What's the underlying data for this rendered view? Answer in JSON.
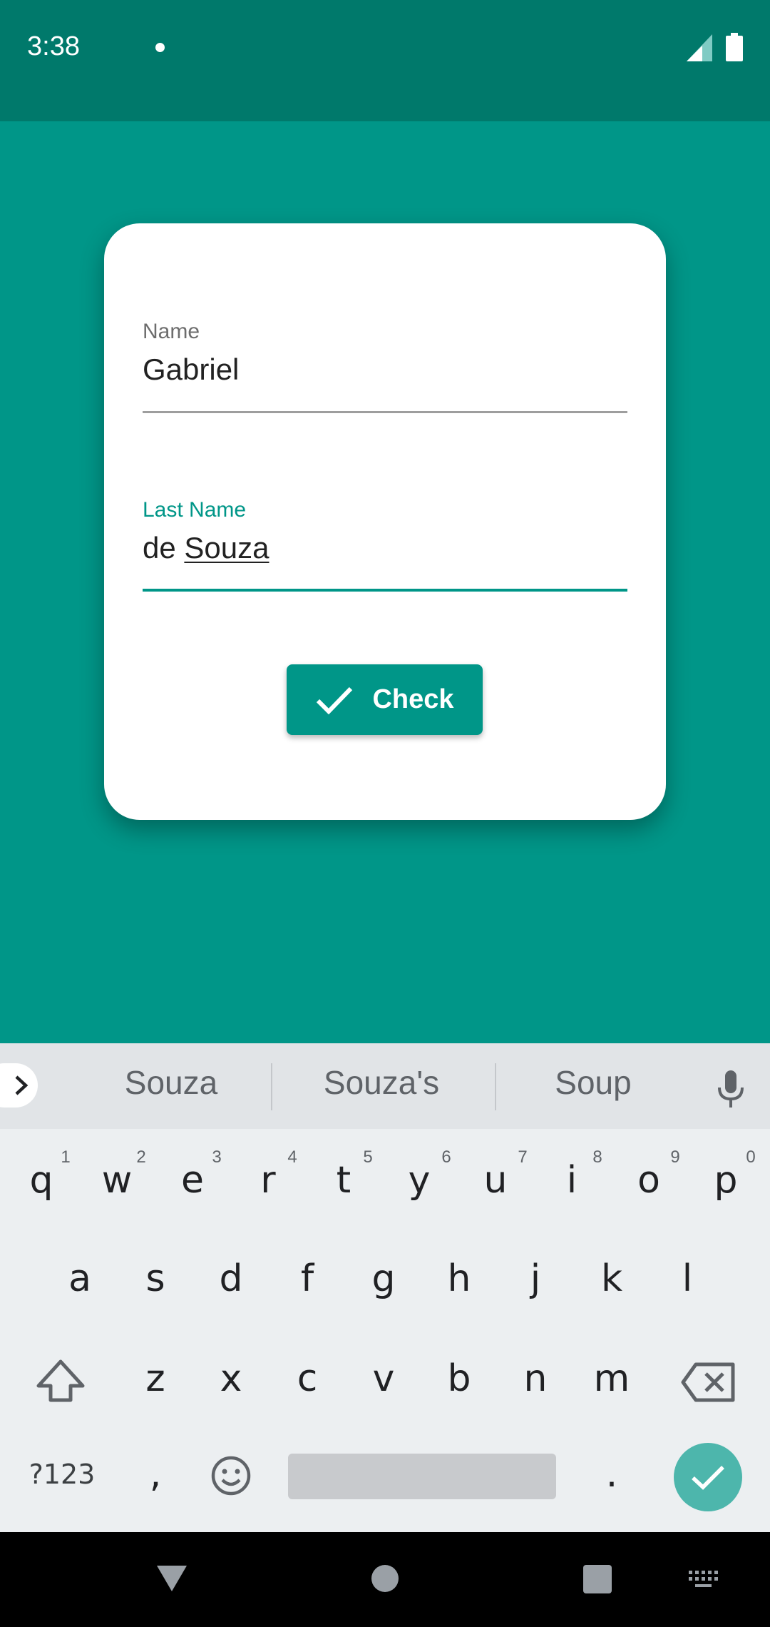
{
  "status_bar": {
    "time": "3:38"
  },
  "form": {
    "name": {
      "label": "Name",
      "value": "Gabriel"
    },
    "last_name": {
      "label": "Last Name",
      "value_prefix": "de ",
      "value_composing": "Souza"
    },
    "check_button": {
      "label": "Check",
      "icon": "check-icon"
    }
  },
  "keyboard": {
    "suggestions": [
      "Souza",
      "Souza's",
      "Soup"
    ],
    "row1": [
      {
        "key": "q",
        "hint": "1"
      },
      {
        "key": "w",
        "hint": "2"
      },
      {
        "key": "e",
        "hint": "3"
      },
      {
        "key": "r",
        "hint": "4"
      },
      {
        "key": "t",
        "hint": "5"
      },
      {
        "key": "y",
        "hint": "6"
      },
      {
        "key": "u",
        "hint": "7"
      },
      {
        "key": "i",
        "hint": "8"
      },
      {
        "key": "o",
        "hint": "9"
      },
      {
        "key": "p",
        "hint": "0"
      }
    ],
    "row2": [
      "a",
      "s",
      "d",
      "f",
      "g",
      "h",
      "j",
      "k",
      "l"
    ],
    "row3": [
      "z",
      "x",
      "c",
      "v",
      "b",
      "n",
      "m"
    ],
    "symbols_key": "?123",
    "comma_key": ",",
    "period_key": ".",
    "icons": [
      "shift-icon",
      "backspace-icon",
      "emoji-icon",
      "mic-icon",
      "enter-check-icon",
      "expand-chevron-icon"
    ]
  },
  "colors": {
    "primary": "#009688",
    "primary_dark": "#00796b",
    "accent_light": "#4db6ac",
    "keyboard_bg": "#eceff1"
  }
}
